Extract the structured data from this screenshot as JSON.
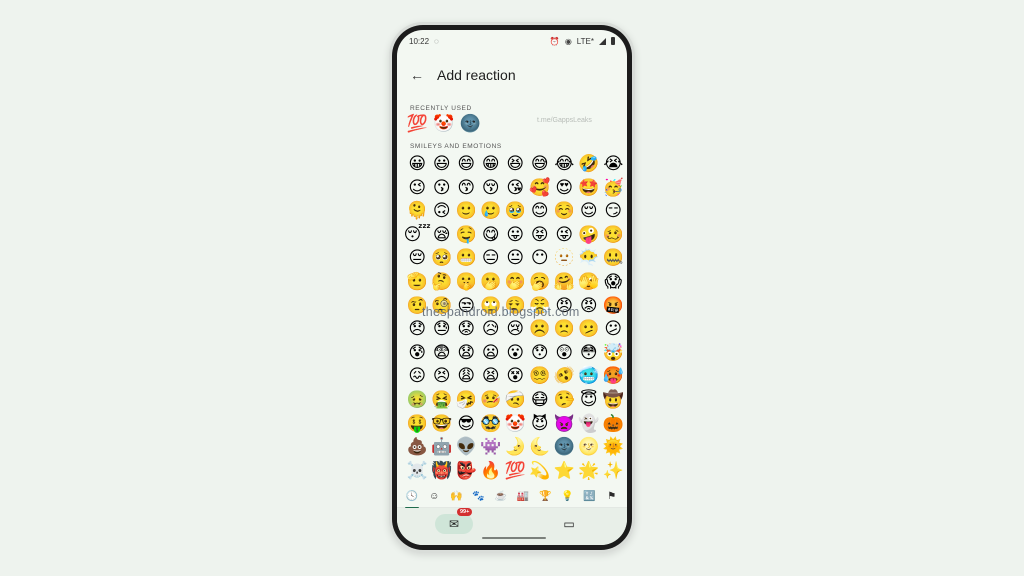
{
  "status_bar": {
    "time": "10:22",
    "left_icon": "shield-icon",
    "right_icons": [
      "alarm-icon",
      "eye-icon",
      "lte-icon",
      "signal-icon",
      "battery-icon"
    ],
    "network": "LTE*"
  },
  "app_bar": {
    "back_icon": "←",
    "title": "Add reaction"
  },
  "recently_used": {
    "label": "RECENTLY USED",
    "emojis": [
      "💯",
      "🤡",
      "🌚"
    ]
  },
  "watermarks": {
    "telegram": "t.me/GappsLeaks",
    "blog": "thespandroid.blogspot.com"
  },
  "smileys": {
    "label": "SMILEYS AND EMOTIONS",
    "emojis": [
      "😀",
      "😃",
      "😄",
      "😁",
      "😆",
      "😅",
      "😂",
      "🤣",
      "😭",
      "😉",
      "😗",
      "😙",
      "😚",
      "😘",
      "🥰",
      "😍",
      "🤩",
      "🥳",
      "🫠",
      "🙃",
      "🙂",
      "🥲",
      "🥹",
      "😊",
      "☺️",
      "😌",
      "😏",
      "😴",
      "😪",
      "🤤",
      "😋",
      "😛",
      "😝",
      "😜",
      "🤪",
      "🥴",
      "😔",
      "🥺",
      "😬",
      "😑",
      "😐",
      "😶",
      "🫥",
      "😶‍🌫️",
      "🤐",
      "🫡",
      "🤔",
      "🤫",
      "🫢",
      "🤭",
      "🥱",
      "🤗",
      "🫣",
      "😱",
      "🤨",
      "🧐",
      "😒",
      "🙄",
      "😮‍💨",
      "😤",
      "😠",
      "😡",
      "🤬",
      "😞",
      "😓",
      "😟",
      "😥",
      "😢",
      "☹️",
      "🙁",
      "🫤",
      "😕",
      "😰",
      "😨",
      "😧",
      "😦",
      "😮",
      "😯",
      "😲",
      "😳",
      "🤯",
      "😖",
      "😣",
      "😩",
      "😫",
      "😵",
      "😵‍💫",
      "🫨",
      "🥶",
      "🥵",
      "🤢",
      "🤮",
      "🤧",
      "🤒",
      "🤕",
      "😷",
      "🤥",
      "😇",
      "🤠",
      "🤑",
      "🤓",
      "😎",
      "🥸",
      "🤡",
      "😈",
      "👿",
      "👻",
      "🎃",
      "💩",
      "🤖",
      "👽",
      "👾",
      "🌛",
      "🌜",
      "🌚",
      "🌝",
      "🌞",
      "☠️",
      "👹",
      "👺",
      "🔥",
      "💯",
      "💫",
      "⭐",
      "🌟",
      "✨"
    ]
  },
  "categories": [
    {
      "name": "recent",
      "glyph": "🕓",
      "active": true
    },
    {
      "name": "smileys",
      "glyph": "☺",
      "active": false
    },
    {
      "name": "people",
      "glyph": "🙌",
      "active": false
    },
    {
      "name": "animals",
      "glyph": "🐾",
      "active": false
    },
    {
      "name": "food",
      "glyph": "☕",
      "active": false
    },
    {
      "name": "travel",
      "glyph": "🏭",
      "active": false
    },
    {
      "name": "activities",
      "glyph": "🏆",
      "active": false
    },
    {
      "name": "objects",
      "glyph": "💡",
      "active": false
    },
    {
      "name": "symbols",
      "glyph": "🔣",
      "active": false
    },
    {
      "name": "flags",
      "glyph": "⚑",
      "active": false
    }
  ],
  "bottom_nav": {
    "mail_icon": "✉",
    "mail_badge": "99+",
    "video_icon": "▭"
  }
}
